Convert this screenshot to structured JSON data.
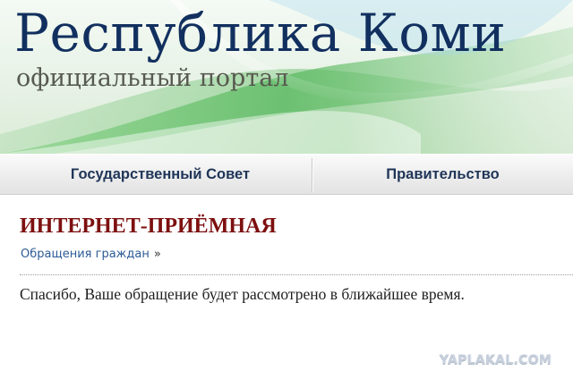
{
  "header": {
    "title": "Республика Коми",
    "subtitle": "официальный портал"
  },
  "nav": {
    "items": [
      {
        "label": "Государственный Совет"
      },
      {
        "label": "Правительство"
      }
    ]
  },
  "main": {
    "heading": "ИНТЕРНЕТ-ПРИЁМНАЯ",
    "breadcrumb": {
      "link": "Обращения граждан",
      "separator": "»"
    },
    "message": "Спасибо, Ваше обращение будет рассмотрено в ближайшее время."
  },
  "watermark": "YAPLAKAL.COM",
  "colors": {
    "title": "#12305f",
    "subtitle": "#575a4f",
    "nav_text": "#1f3558",
    "heading": "#7d1010",
    "link": "#2d5b96",
    "header_green": "#5fbf62"
  }
}
